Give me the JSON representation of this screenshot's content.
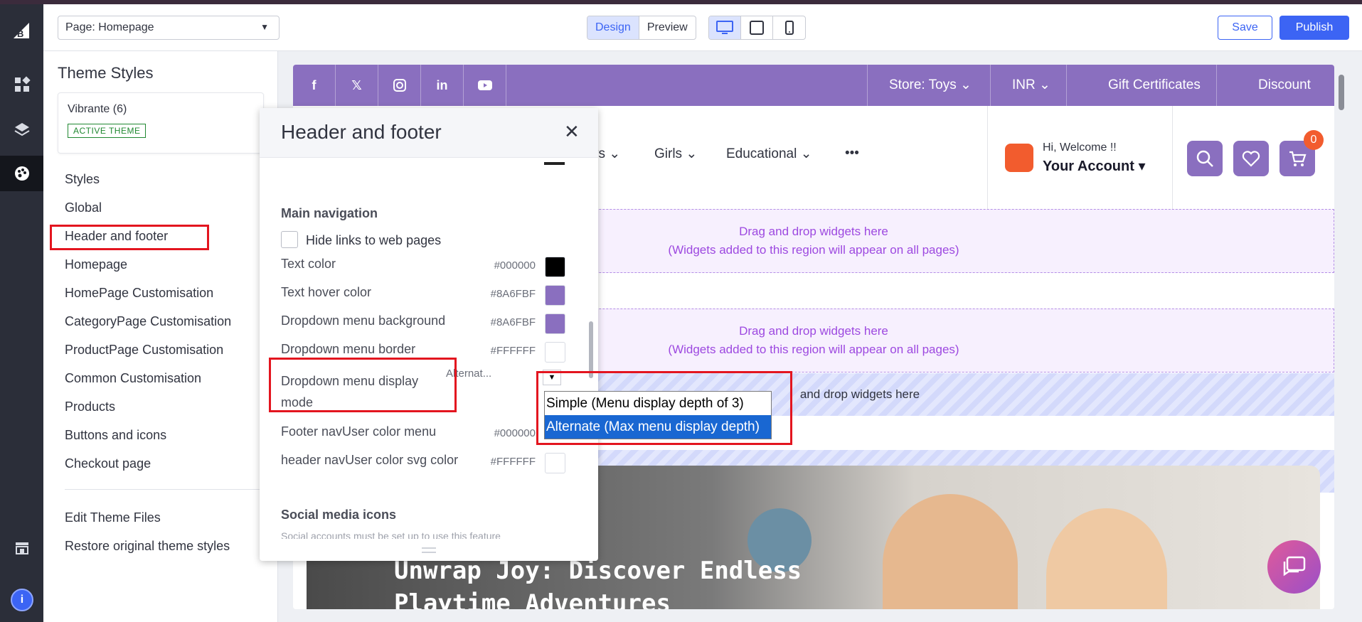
{
  "toolbar": {
    "page_select": "Page: Homepage",
    "design_label": "Design",
    "preview_label": "Preview",
    "save_label": "Save",
    "publish_label": "Publish"
  },
  "sidebar": {
    "title": "Theme Styles",
    "theme_name": "Vibrante (6)",
    "theme_badge": "ACTIVE THEME",
    "items": [
      {
        "label": "Styles"
      },
      {
        "label": "Global"
      },
      {
        "label": "Header and footer"
      },
      {
        "label": "Homepage"
      },
      {
        "label": "HomePage Customisation"
      },
      {
        "label": "CategoryPage Customisation"
      },
      {
        "label": "ProductPage Customisation"
      },
      {
        "label": "Common Customisation"
      },
      {
        "label": "Products"
      },
      {
        "label": "Buttons and icons"
      },
      {
        "label": "Checkout page"
      }
    ],
    "footer_items": [
      {
        "label": "Edit Theme Files"
      },
      {
        "label": "Restore original theme styles"
      }
    ]
  },
  "modal": {
    "title": "Header and footer",
    "main_nav_heading": "Main navigation",
    "hide_links_label": "Hide links to web pages",
    "rows": [
      {
        "label": "Text color",
        "hex": "#000000",
        "color": "#000000"
      },
      {
        "label": "Text hover color",
        "hex": "#8A6FBF",
        "color": "#8A6FBF"
      },
      {
        "label": "Dropdown menu background",
        "hex": "#8A6FBF",
        "color": "#8A6FBF"
      },
      {
        "label": "Dropdown menu border",
        "hex": "#FFFFFF",
        "color": "#FFFFFF"
      }
    ],
    "mode_label_1": "Dropdown menu display",
    "mode_label_2": "mode",
    "mode_value": "Alternat...",
    "rows2": [
      {
        "label": "Footer navUser color menu",
        "hex": "#000000",
        "color": "#000000"
      },
      {
        "label": "header navUser color svg color",
        "hex": "#FFFFFF",
        "color": "#FFFFFF"
      }
    ],
    "social_heading": "Social media icons",
    "social_note": "Social accounts must be set up to use this feature"
  },
  "dropdown": {
    "options": [
      {
        "label": "Simple (Menu display depth of 3)"
      },
      {
        "label": "Alternate (Max menu display depth)"
      }
    ]
  },
  "store": {
    "social_icons": [
      "facebook-icon",
      "x-icon",
      "instagram-icon",
      "linkedin-icon",
      "youtube-icon"
    ],
    "store_label": "Store: Toys ⌄",
    "currency_label": "INR ⌄",
    "gift_label": "Gift Certificates",
    "discount_label": "Discount",
    "nav": [
      {
        "label": "ys ⌄"
      },
      {
        "label": "Girls ⌄"
      },
      {
        "label": "Educational ⌄"
      },
      {
        "label": "•••"
      }
    ],
    "welcome": "Hi, Welcome !!",
    "account": "Your Account ▾",
    "cart_count": "0",
    "dropzone_line1": "Drag and drop widgets here",
    "dropzone_line2": "(Widgets added to this region will appear on all pages)",
    "stripe_text": "and drop widgets here",
    "hero_line1": "Unwrap Joy: Discover Endless",
    "hero_line2": "Playtime Adventures"
  },
  "colors": {
    "accent": "#3c64f4",
    "store_purple": "#8a6fbf",
    "highlight_red": "#e3151f"
  }
}
